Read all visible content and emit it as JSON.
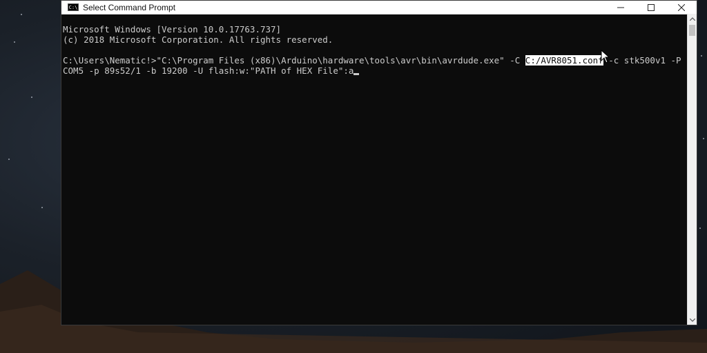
{
  "window": {
    "title": "Select Command Prompt",
    "app_icon_text": "C:\\"
  },
  "controls": {
    "minimize_icon": "minimize-icon",
    "maximize_icon": "maximize-icon",
    "close_icon": "close-icon"
  },
  "console": {
    "line1": "Microsoft Windows [Version 10.0.17763.737]",
    "line2": "(c) 2018 Microsoft Corporation. All rights reserved.",
    "line3_before": "C:\\Users\\Nematic!>\"C:\\Program Files (x86)\\Arduino\\hardware\\tools\\avr\\bin\\avrdude.exe\" -C ",
    "line3_selected": "C:/AVR8051.conf",
    "line3_after": " -c stk500v1 -P",
    "line4": "COM5 -p 89s52/1 -b 19200 -U flash:w:\"PATH of HEX File\":a"
  },
  "colors": {
    "console_bg": "#0c0c0c",
    "console_text": "#cccccc",
    "selection_bg": "#ffffff"
  }
}
